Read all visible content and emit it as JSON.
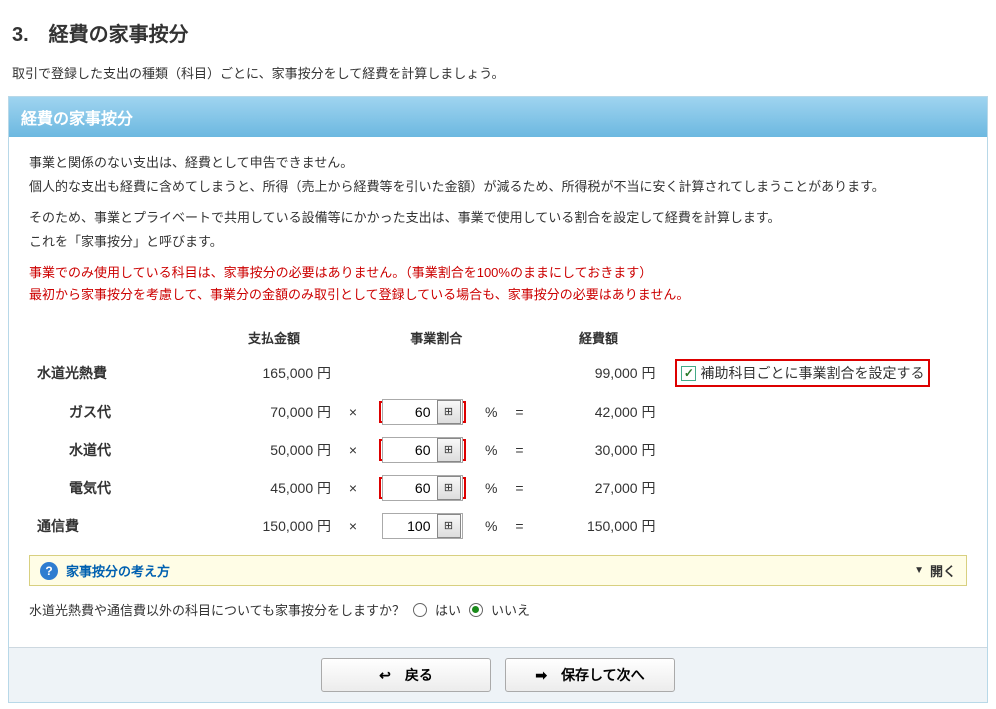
{
  "page": {
    "title": "3.　経費の家事按分",
    "subtitle": "取引で登録した支出の種類（科目）ごとに、家事按分をして経費を計算しましょう。"
  },
  "panel": {
    "header": "経費の家事按分",
    "desc": [
      "事業と関係のない支出は、経費として申告できません。",
      "個人的な支出も経費に含めてしまうと、所得（売上から経費等を引いた金額）が減るため、所得税が不当に安く計算されてしまうことがあります。",
      "そのため、事業とプライベートで共用している設備等にかかった支出は、事業で使用している割合を設定して経費を計算します。",
      "これを「家事按分」と呼びます。"
    ],
    "desc_red": [
      "事業でのみ使用している科目は、家事按分の必要はありません。（事業割合を100%のままにしておきます）",
      "最初から家事按分を考慮して、事業分の金額のみ取引として登録している場合も、家事按分の必要はありません。"
    ]
  },
  "table": {
    "headers": {
      "amount": "支払金額",
      "ratio": "事業割合",
      "expense": "経費額"
    },
    "checkbox_label": "補助科目ごとに事業割合を設定する",
    "rows": {
      "utilities": {
        "label": "水道光熱費",
        "amount": "165,000 円",
        "expense": "99,000 円"
      },
      "gas": {
        "label": "ガス代",
        "amount": "70,000 円",
        "ratio": "60",
        "expense": "42,000 円"
      },
      "water": {
        "label": "水道代",
        "amount": "50,000 円",
        "ratio": "60",
        "expense": "30,000 円"
      },
      "elec": {
        "label": "電気代",
        "amount": "45,000 円",
        "ratio": "60",
        "expense": "27,000 円"
      },
      "comm": {
        "label": "通信費",
        "amount": "150,000 円",
        "ratio": "100",
        "expense": "150,000 円"
      }
    },
    "symbols": {
      "mul": "×",
      "pct": "%",
      "eq": "="
    }
  },
  "accordion": {
    "title": "家事按分の考え方",
    "open_label": "開く"
  },
  "question": {
    "text": "水道光熱費や通信費以外の科目についても家事按分をしますか？",
    "yes": "はい",
    "no": "いいえ"
  },
  "footer": {
    "back": "戻る",
    "save_next": "保存して次へ"
  }
}
